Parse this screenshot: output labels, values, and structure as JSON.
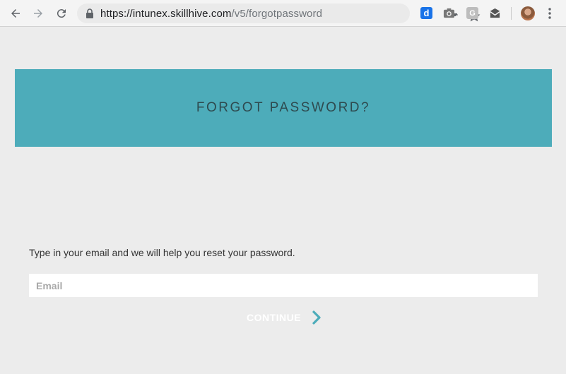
{
  "browser": {
    "url_host": "https://intunex.skillhive.com",
    "url_path": "/v5/forgotpassword",
    "extension_d_label": "d",
    "extension_g_label": "G"
  },
  "banner": {
    "title": "FORGOT PASSWORD?",
    "background_color": "#4dacba"
  },
  "form": {
    "instructions": "Type in your email and we will help you reset your password.",
    "email_placeholder": "Email",
    "email_value": "",
    "continue_label": "CONTINUE"
  },
  "colors": {
    "page_background": "#ececec",
    "accent": "#4dacba"
  }
}
